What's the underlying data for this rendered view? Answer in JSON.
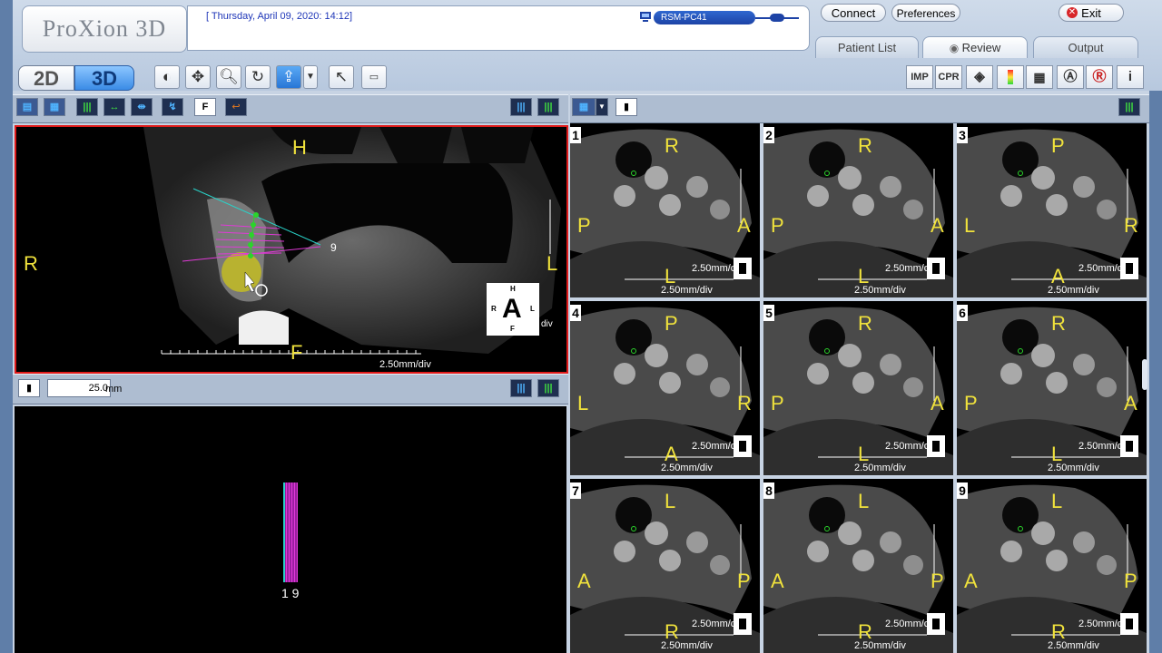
{
  "app": {
    "logo": "ProXion 3D",
    "datetime": "[ Thursday, April 09, 2020: 14:12]",
    "pc_name": "RSM-PC41"
  },
  "header_buttons": {
    "connect": "Connect",
    "preferences": "Preferences",
    "exit": "Exit"
  },
  "tabs": {
    "patient_list": "Patient List",
    "review": "Review",
    "output": "Output"
  },
  "mode": {
    "two_d": "2D",
    "three_d": "3D"
  },
  "right_tools": [
    "IMP",
    "CPR"
  ],
  "main_view": {
    "labels": {
      "top": "H",
      "left": "R",
      "right": "L",
      "bottom": "F"
    },
    "scale": "2.50mm/div",
    "marker_number": "9",
    "orientation": {
      "top": "H",
      "left": "R",
      "right": "L",
      "center": "A",
      "bottom": "F",
      "suffix": "div"
    }
  },
  "thickness": {
    "value": "25.0",
    "unit": "mm"
  },
  "strip_view": {
    "numbers": "1 9"
  },
  "cells": [
    {
      "n": "1",
      "top": "R",
      "left": "P",
      "right": "A",
      "bottom": "L",
      "scale": "2.50mm/div",
      "scale_short": "2.50mm/c"
    },
    {
      "n": "2",
      "top": "R",
      "left": "P",
      "right": "A",
      "bottom": "L",
      "scale": "2.50mm/div",
      "scale_short": "2.50mm/c"
    },
    {
      "n": "3",
      "top": "P",
      "left": "L",
      "right": "R",
      "bottom": "A",
      "scale": "2.50mm/div",
      "scale_short": "2.50mm/c"
    },
    {
      "n": "4",
      "top": "P",
      "left": "L",
      "right": "R",
      "bottom": "A",
      "scale": "2.50mm/div",
      "scale_short": "2.50mm/c"
    },
    {
      "n": "5",
      "top": "R",
      "left": "P",
      "right": "A",
      "bottom": "L",
      "scale": "2.50mm/div",
      "scale_short": "2.50mm/c"
    },
    {
      "n": "6",
      "top": "R",
      "left": "P",
      "right": "A",
      "bottom": "L",
      "scale": "2.50mm/div",
      "scale_short": "2.50mm/c"
    },
    {
      "n": "7",
      "top": "L",
      "left": "A",
      "right": "P",
      "bottom": "R",
      "scale": "2.50mm/div",
      "scale_short": "2.50mm/c"
    },
    {
      "n": "8",
      "top": "L",
      "left": "A",
      "right": "P",
      "bottom": "R",
      "scale": "2.50mm/div",
      "scale_short": "2.50mm/c"
    },
    {
      "n": "9",
      "top": "L",
      "left": "A",
      "right": "P",
      "bottom": "R",
      "scale": "2.50mm/div",
      "scale_short": "2.50mm/c"
    }
  ]
}
